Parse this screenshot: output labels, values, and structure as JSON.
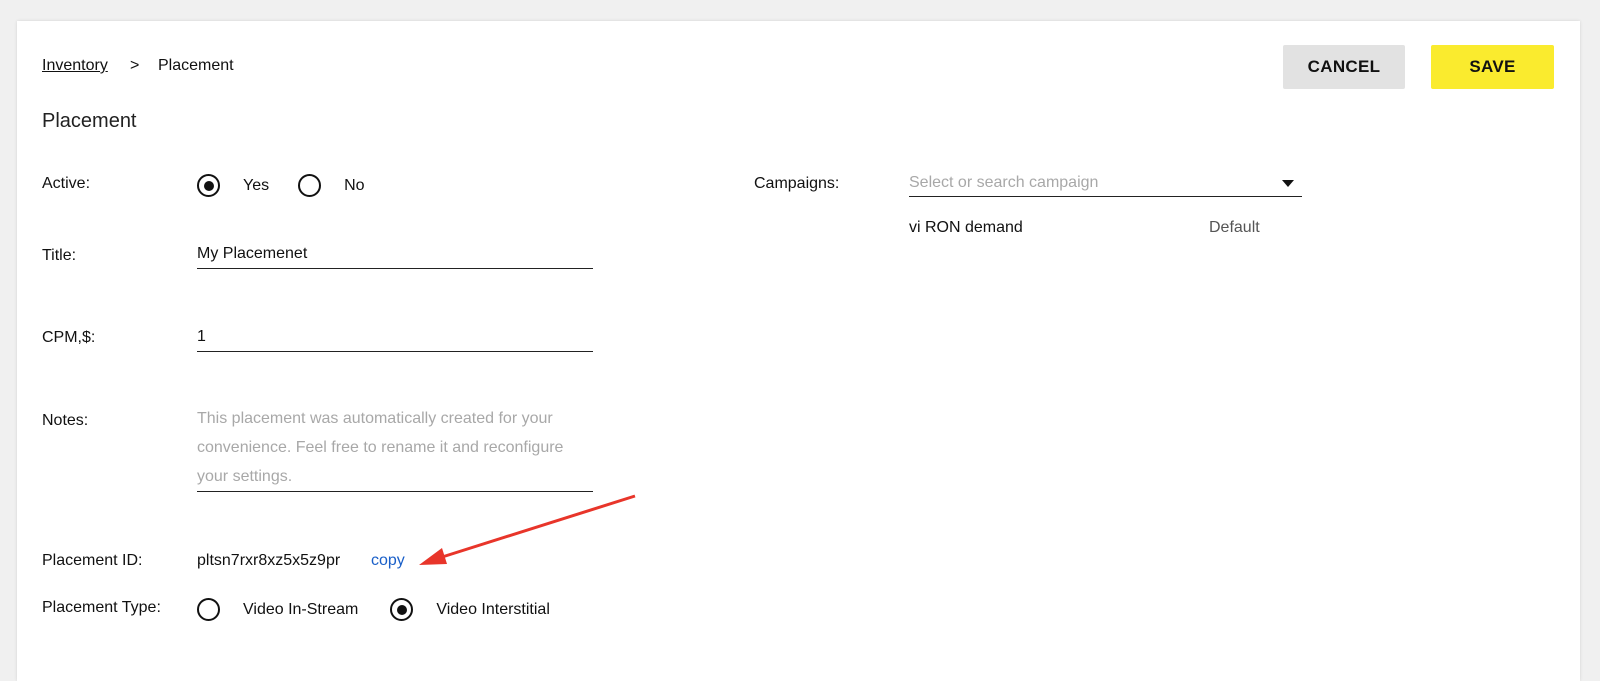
{
  "breadcrumb": {
    "parent": "Inventory",
    "separator": ">",
    "current": "Placement"
  },
  "actions": {
    "cancel_label": "CANCEL",
    "save_label": "SAVE"
  },
  "page_title": "Placement",
  "form": {
    "active": {
      "label": "Active:",
      "options": [
        "Yes",
        "No"
      ],
      "selected": "Yes"
    },
    "title": {
      "label": "Title:",
      "value": "My Placemenet"
    },
    "cpm": {
      "label": "CPM,$:",
      "value": "1"
    },
    "notes": {
      "label": "Notes:",
      "placeholder": "This placement was automatically created for your convenience. Feel free to rename it and reconfigure your settings."
    },
    "placement_id": {
      "label": "Placement ID:",
      "value": "pltsn7rxr8xz5x5z9pr",
      "copy_label": "copy"
    },
    "placement_type": {
      "label": "Placement Type:",
      "options": [
        "Video In-Stream",
        "Video Interstitial"
      ],
      "selected": "Video Interstitial"
    }
  },
  "campaigns": {
    "label": "Campaigns:",
    "placeholder": "Select or search campaign",
    "items": [
      {
        "name": "vi RON demand",
        "tag": "Default"
      }
    ]
  },
  "colors": {
    "save_button": "#faeb2e",
    "cancel_button": "#e2e2e2",
    "link": "#1a5fc8",
    "annotation_arrow": "#e8352a"
  }
}
